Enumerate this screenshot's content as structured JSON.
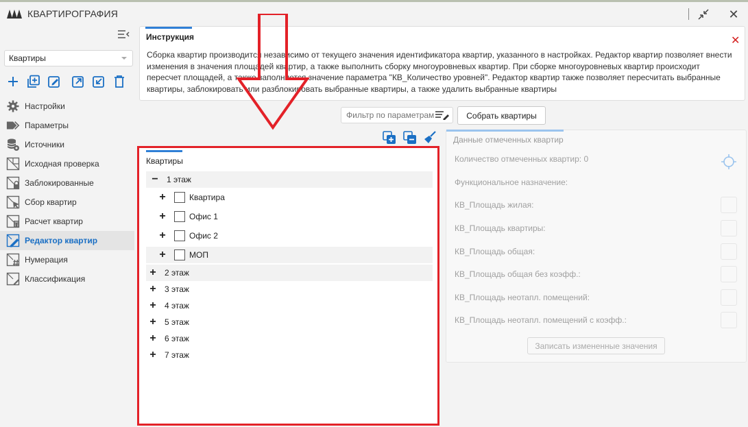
{
  "window": {
    "title": "КВАРТИРОГРАФИЯ"
  },
  "sidebar": {
    "combo_value": "Квартиры",
    "toolbar": [
      "add-icon",
      "add-box-icon",
      "edit-icon",
      "export-icon",
      "import-icon",
      "delete-icon"
    ],
    "items": [
      {
        "label": "Настройки",
        "icon": "gear-icon"
      },
      {
        "label": "Параметры",
        "icon": "tag-icon"
      },
      {
        "label": "Источники",
        "icon": "database-icon"
      },
      {
        "label": "Исходная проверка",
        "icon": "check-plan-icon"
      },
      {
        "label": "Заблокированные",
        "icon": "lock-plan-icon"
      },
      {
        "label": "Сбор квартир",
        "icon": "cursor-plan-icon"
      },
      {
        "label": "Расчет квартир",
        "icon": "calc-plan-icon"
      },
      {
        "label": "Редактор квартир",
        "icon": "edit-plan-icon",
        "active": true
      },
      {
        "label": "Нумерация",
        "icon": "number-plan-icon"
      },
      {
        "label": "Классификация",
        "icon": "class-plan-icon"
      }
    ]
  },
  "instruction": {
    "title": "Инструкция",
    "text": "Сборка квартир производится независимо от текущего значения идентификатора квартир, указанного в настройках. Редактор квартир позволяет внести изменения в значения площадей квартир, а также выполнить сборку многоуровневых квартир. При сборке многоуровневых квартир происходит пересчет площадей, а также заполняется значение параметра \"КВ_Количество уровней\". Редактор квартир также позволяет пересчитать выбранные квартиры, заблокировать или разблокировать выбранные квартиры, а также удалить выбранные квартиры"
  },
  "filter": {
    "placeholder": "Фильтр по параметрам"
  },
  "buttons": {
    "build": "Собрать квартиры",
    "write": "Записать измененные значения"
  },
  "tree": {
    "title": "Квартиры",
    "floors": [
      {
        "label": "1 этаж",
        "expanded": true,
        "children": [
          "Квартира",
          "Офис 1",
          "Офис 2",
          "МОП"
        ]
      },
      {
        "label": "2 этаж",
        "expanded": false
      },
      {
        "label": "3 этаж",
        "expanded": false
      },
      {
        "label": "4 этаж",
        "expanded": false
      },
      {
        "label": "5 этаж",
        "expanded": false
      },
      {
        "label": "6 этаж",
        "expanded": false
      },
      {
        "label": "7 этаж",
        "expanded": false
      }
    ]
  },
  "data_panel": {
    "title": "Данные отмеченных квартир",
    "count_label": "Количество отмеченных квартир: 0",
    "function_label": "Функциональное назначение:",
    "fields": [
      "КВ_Площадь жилая:",
      "КВ_Площадь квартиры:",
      "КВ_Площадь общая:",
      "КВ_Площадь общая без коэфф.:",
      "КВ_Площадь неотапл. помещений:",
      "КВ_Площадь неотапл. помещений с коэфф.:"
    ]
  },
  "colors": {
    "accent": "#2f7fd6",
    "highlight_border": "#e32128",
    "close_red": "#d42020"
  }
}
